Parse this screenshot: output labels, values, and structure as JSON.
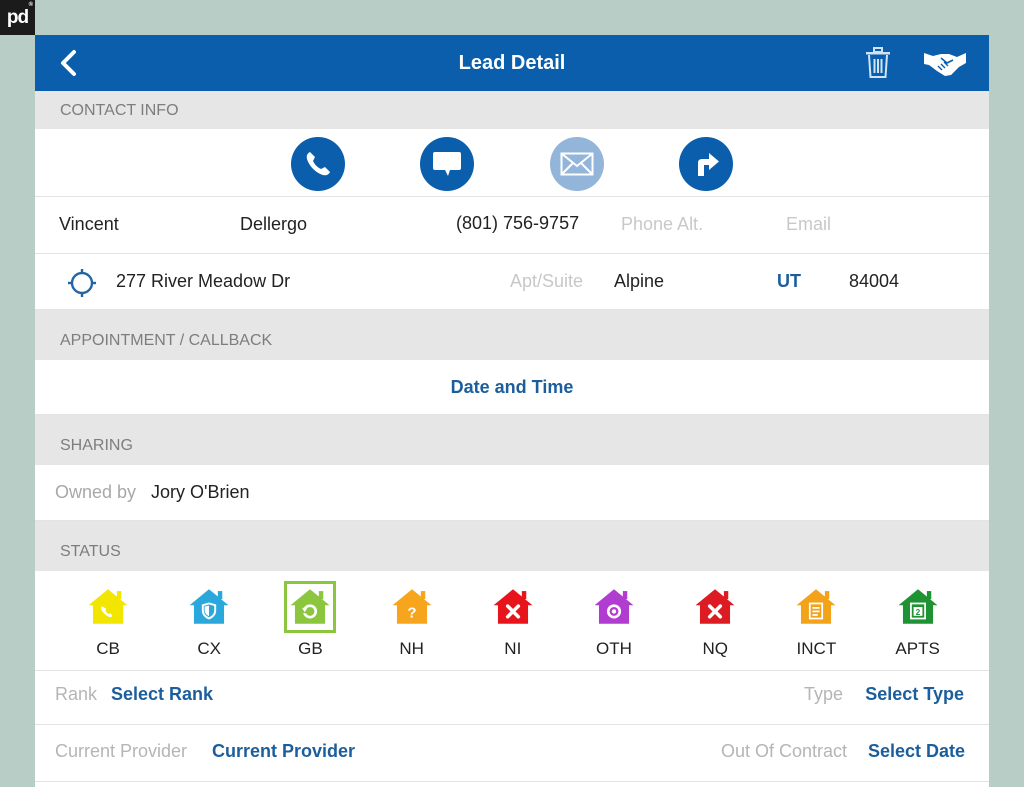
{
  "logo": {
    "text": "pd",
    "mark": "®"
  },
  "navbar": {
    "title": "Lead Detail",
    "back_icon": "chevron-left-icon",
    "trash_icon": "trash-icon",
    "handshake_icon": "handshake-icon"
  },
  "contact": {
    "header": "CONTACT INFO",
    "actions": [
      {
        "name": "call",
        "icon": "phone-icon",
        "enabled": true
      },
      {
        "name": "message",
        "icon": "chat-bubble-icon",
        "enabled": true
      },
      {
        "name": "email",
        "icon": "envelope-icon",
        "enabled": false
      },
      {
        "name": "directions",
        "icon": "turn-right-arrow-icon",
        "enabled": true
      }
    ],
    "first_name": "Vincent",
    "last_name": "Dellergo",
    "phone": "(801) 756-9757",
    "phone_alt_placeholder": "Phone Alt.",
    "email_placeholder": "Email",
    "address": "277 River Meadow Dr",
    "apt_placeholder": "Apt/Suite",
    "city": "Alpine",
    "state": "UT",
    "zip": "84004"
  },
  "appointment": {
    "header": "APPOINTMENT / CALLBACK",
    "date_time_label": "Date and Time"
  },
  "sharing": {
    "header": "SHARING",
    "owned_by_label": "Owned by",
    "owner": "Jory O'Brien"
  },
  "status": {
    "header": "STATUS",
    "selected": "GB",
    "items": [
      {
        "code": "CB",
        "color": "#f2e600",
        "glyph": "phone"
      },
      {
        "code": "CX",
        "color": "#2aa7db",
        "glyph": "shield"
      },
      {
        "code": "GB",
        "color": "#8cc63f",
        "glyph": "refresh"
      },
      {
        "code": "NH",
        "color": "#f7a51c",
        "glyph": "question"
      },
      {
        "code": "NI",
        "color": "#e8141b",
        "glyph": "x"
      },
      {
        "code": "OTH",
        "color": "#b03cd0",
        "glyph": "circle"
      },
      {
        "code": "NQ",
        "color": "#dc1c22",
        "glyph": "x"
      },
      {
        "code": "INCT",
        "color": "#f2a31a",
        "glyph": "document"
      },
      {
        "code": "APTS",
        "color": "#1f9234",
        "glyph": "calendar-2"
      }
    ],
    "rank_label": "Rank",
    "rank_value": "Select Rank",
    "type_label": "Type",
    "type_value": "Select Type",
    "provider_label": "Current Provider",
    "provider_value": "Current Provider",
    "contract_label": "Out Of Contract",
    "contract_value": "Select Date"
  },
  "colors": {
    "brand_blue": "#0a5eab",
    "link_blue": "#1c5e9c",
    "section_gray": "#e6e6e6",
    "backdrop": "#b8cdc6",
    "selected_border": "#8cc63f"
  }
}
